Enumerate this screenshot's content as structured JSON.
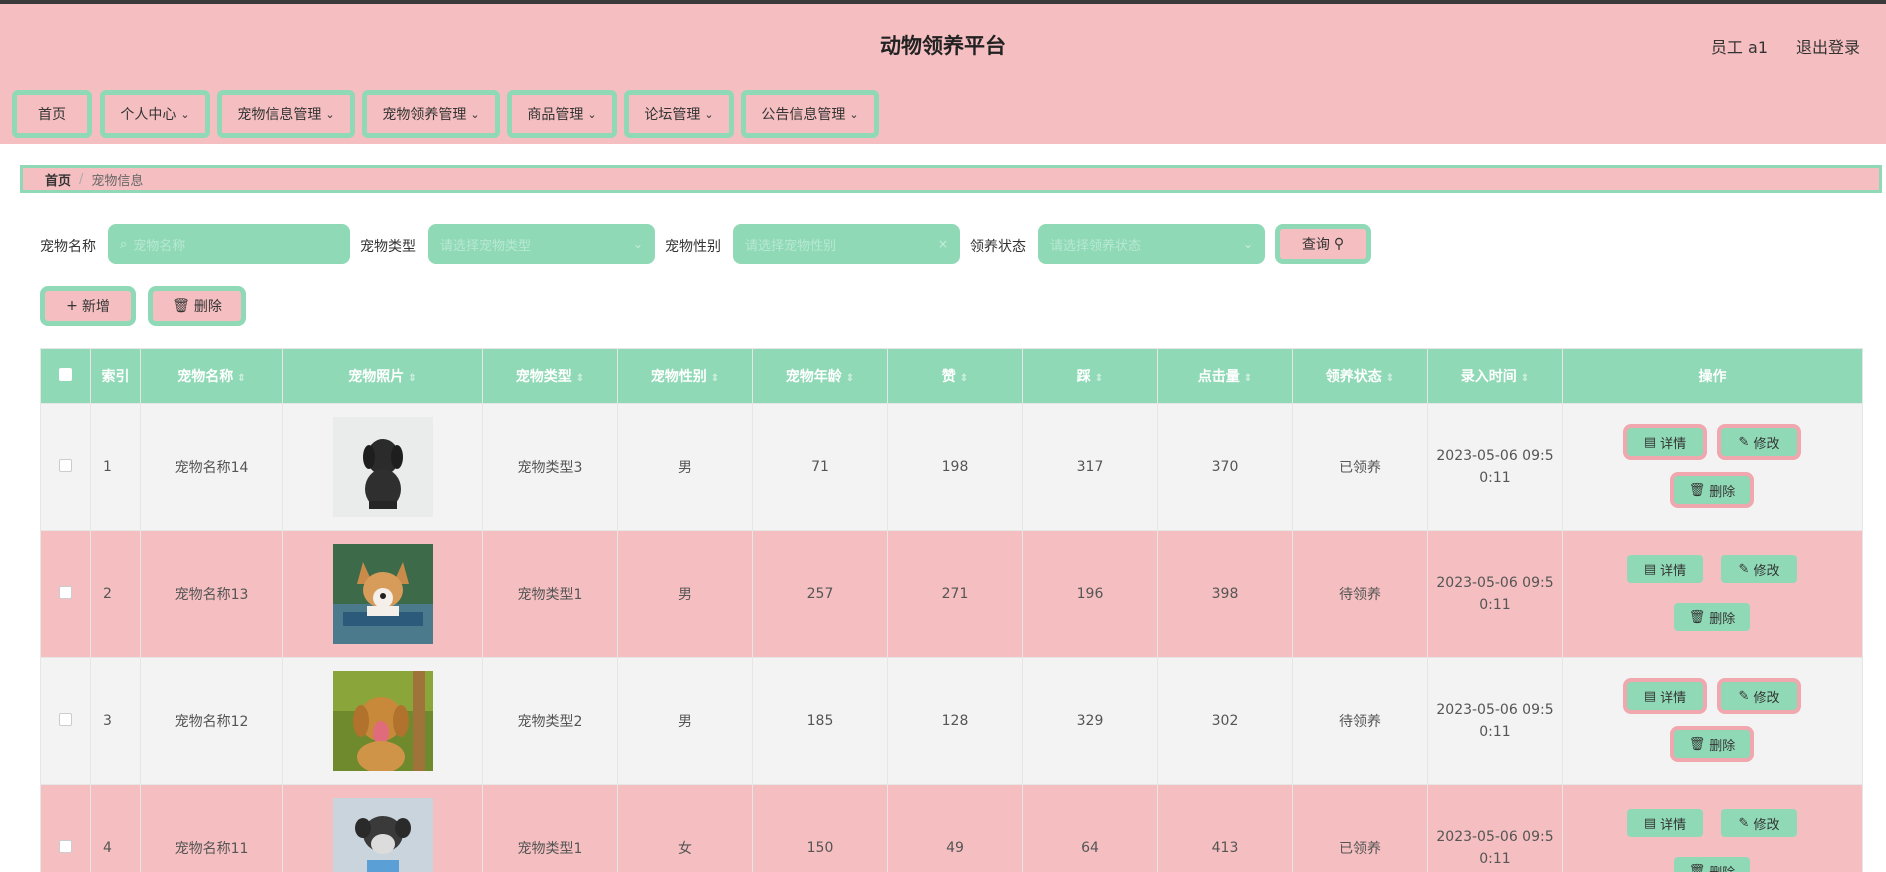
{
  "header": {
    "title": "动物领养平台",
    "user": "员工 a1",
    "logout": "退出登录"
  },
  "nav": [
    {
      "label": "首页",
      "has_dropdown": false
    },
    {
      "label": "个人中心",
      "has_dropdown": true
    },
    {
      "label": "宠物信息管理",
      "has_dropdown": true
    },
    {
      "label": "宠物领养管理",
      "has_dropdown": true
    },
    {
      "label": "商品管理",
      "has_dropdown": true
    },
    {
      "label": "论坛管理",
      "has_dropdown": true
    },
    {
      "label": "公告信息管理",
      "has_dropdown": true
    }
  ],
  "breadcrumb": {
    "home": "首页",
    "sep": "/",
    "current": "宠物信息"
  },
  "search": {
    "name_label": "宠物名称",
    "name_placeholder": "宠物名称",
    "type_label": "宠物类型",
    "type_placeholder": "请选择宠物类型",
    "gender_label": "宠物性别",
    "gender_placeholder": "请选择宠物性别",
    "status_label": "领养状态",
    "status_placeholder": "请选择领养状态",
    "query_label": "查询"
  },
  "actions": {
    "add_label": "新增",
    "delete_label": "删除"
  },
  "table": {
    "columns": [
      "",
      "索引",
      "宠物名称",
      "宠物照片",
      "宠物类型",
      "宠物性别",
      "宠物年龄",
      "赞",
      "踩",
      "点击量",
      "领养状态",
      "录入时间",
      "操作"
    ],
    "sortable": [
      false,
      false,
      true,
      true,
      true,
      true,
      true,
      true,
      true,
      true,
      true,
      true,
      false
    ],
    "rows": [
      {
        "index": "1",
        "name": "宠物名称14",
        "photo": "black-puppy-photo",
        "type": "宠物类型3",
        "gender": "男",
        "age": "71",
        "like": "198",
        "dislike": "317",
        "clicks": "370",
        "status": "已领养",
        "time1": "2023-05-06 09:5",
        "time2": "0:11"
      },
      {
        "index": "2",
        "name": "宠物名称13",
        "photo": "corgi-photo",
        "type": "宠物类型1",
        "gender": "男",
        "age": "257",
        "like": "271",
        "dislike": "196",
        "clicks": "398",
        "status": "待领养",
        "time1": "2023-05-06 09:5",
        "time2": "0:11"
      },
      {
        "index": "3",
        "name": "宠物名称12",
        "photo": "golden-retriever-photo",
        "type": "宠物类型2",
        "gender": "男",
        "age": "185",
        "like": "128",
        "dislike": "329",
        "clicks": "302",
        "status": "待领养",
        "time1": "2023-05-06 09:5",
        "time2": "0:11"
      },
      {
        "index": "4",
        "name": "宠物名称11",
        "photo": "schnauzer-photo",
        "type": "宠物类型1",
        "gender": "女",
        "age": "150",
        "like": "49",
        "dislike": "64",
        "clicks": "413",
        "status": "已领养",
        "time1": "2023-05-06 09:5",
        "time2": "0:11"
      }
    ],
    "ops": {
      "detail": "详情",
      "edit": "修改",
      "delete": "删除"
    }
  },
  "colors": {
    "pink": "#f5bfc1",
    "mint": "#8fd9b6",
    "ring_pink": "#f0a7ad"
  }
}
